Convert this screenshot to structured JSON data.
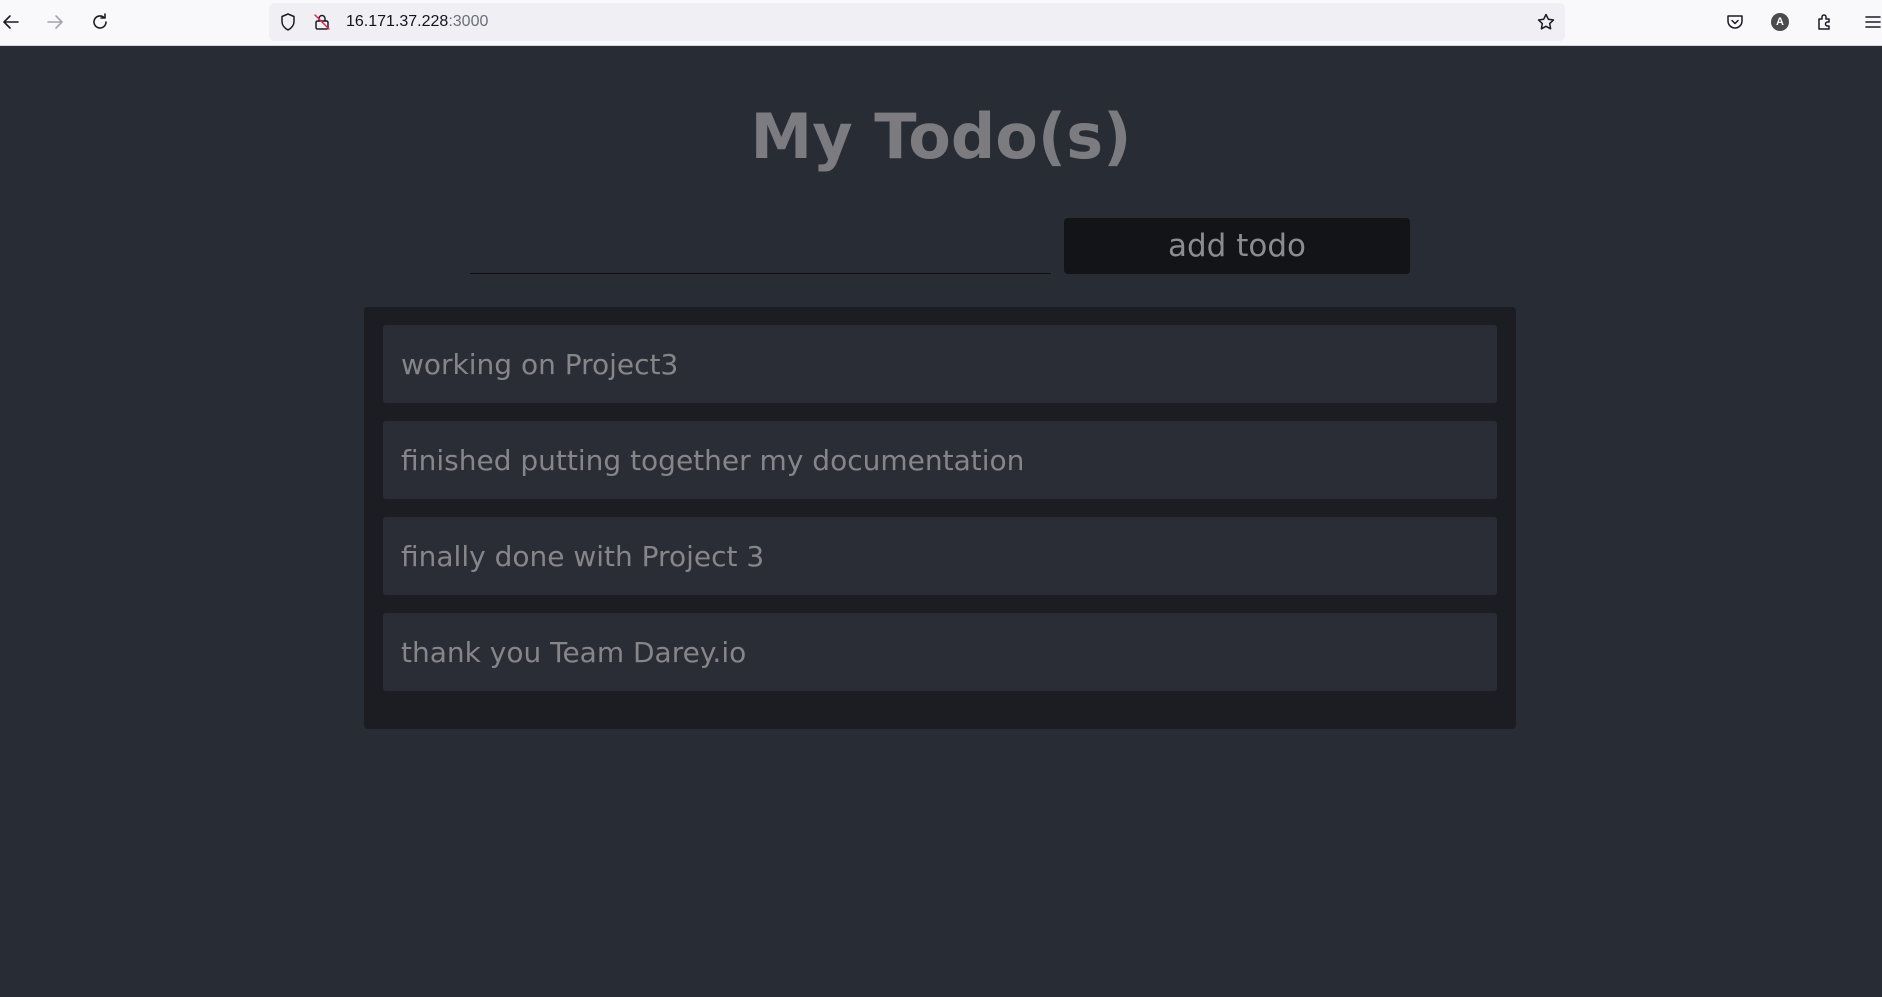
{
  "browser": {
    "url_host": "16.171.37.228",
    "url_port": ":3000",
    "avatar_letter": "A",
    "icons": [
      "back-icon",
      "forward-icon",
      "reload-icon",
      "shield-icon",
      "insecure-lock-icon",
      "bookmark-star-icon",
      "pocket-icon",
      "account-icon",
      "extensions-icon",
      "menu-icon"
    ]
  },
  "app": {
    "title": "My Todo(s)",
    "input": {
      "value": "",
      "placeholder": ""
    },
    "add_button_label": "add todo",
    "todos": [
      {
        "text": "working on Project3"
      },
      {
        "text": "finished putting together my documentation"
      },
      {
        "text": "finally done with Project 3"
      },
      {
        "text": "thank you Team Darey.io"
      }
    ]
  },
  "colors": {
    "page_background": "#282c34",
    "list_panel": "#1b1d22",
    "todo_item": "#2a2d36",
    "button": "#131417",
    "text": "#85858a"
  }
}
